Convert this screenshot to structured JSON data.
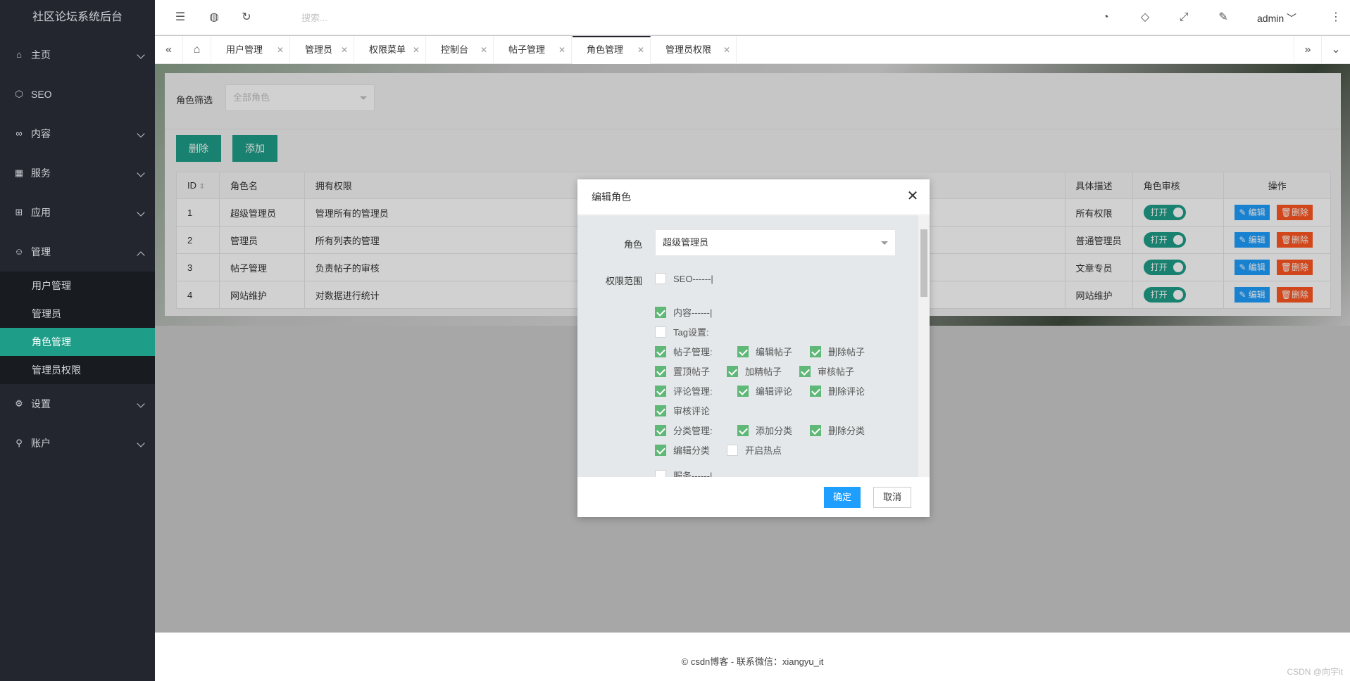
{
  "sidebar": {
    "title": "社区论坛系统后台",
    "groups": [
      {
        "label": "主页",
        "icon": "home-icon"
      },
      {
        "label": "SEO",
        "icon": "cube-icon"
      },
      {
        "label": "内容",
        "icon": "binoculars-icon"
      },
      {
        "label": "服务",
        "icon": "grid-icon"
      },
      {
        "label": "应用",
        "icon": "apps-icon"
      },
      {
        "label": "管理",
        "icon": "users-icon"
      },
      {
        "label": "设置",
        "icon": "gear-icon"
      },
      {
        "label": "账户",
        "icon": "user-icon"
      }
    ],
    "sub_items": [
      "用户管理",
      "管理员",
      "角色管理",
      "管理员权限"
    ],
    "active_sub": "角色管理"
  },
  "topbar": {
    "search_placeholder": "搜索...",
    "user": "admin"
  },
  "tabs": [
    {
      "label": "用户管理"
    },
    {
      "label": "管理员"
    },
    {
      "label": "权限菜单"
    },
    {
      "label": "控制台"
    },
    {
      "label": "帖子管理"
    },
    {
      "label": "角色管理",
      "active": true
    },
    {
      "label": "管理员权限"
    }
  ],
  "filter": {
    "label": "角色筛选",
    "placeholder": "全部角色"
  },
  "buttons": {
    "delete": "删除",
    "add": "添加"
  },
  "table": {
    "headers": [
      "ID",
      "角色名",
      "拥有权限",
      "具体描述",
      "角色审核",
      "操作"
    ],
    "rows": [
      {
        "id": "1",
        "name": "超级管理员",
        "perm": "管理所有的管理员",
        "desc": "所有权限"
      },
      {
        "id": "2",
        "name": "管理员",
        "perm": "所有列表的管理",
        "desc": "普通管理员"
      },
      {
        "id": "3",
        "name": "帖子管理",
        "perm": "负责帖子的审核",
        "desc": "文章专员"
      },
      {
        "id": "4",
        "name": "网站维护",
        "perm": "对数据进行统计",
        "desc": "网站维护"
      }
    ],
    "toggle_label": "打开",
    "edit_label": "编辑",
    "delete_label": "删除"
  },
  "modal": {
    "title": "编辑角色",
    "role_label": "角色",
    "role_value": "超级管理员",
    "scope_label": "权限范围",
    "checks": {
      "seo": "SEO------|",
      "content": "内容------|",
      "tag": "Tag设置:",
      "post_mgmt": "帖子管理:",
      "post_edit": "编辑帖子",
      "post_delete": "删除帖子",
      "post_top": "置顶帖子",
      "post_feature": "加精帖子",
      "post_review": "审核帖子",
      "comment_mgmt": "评论管理:",
      "comment_edit": "编辑评论",
      "comment_delete": "删除评论",
      "comment_review": "审核评论",
      "cat_mgmt": "分类管理:",
      "cat_add": "添加分类",
      "cat_delete": "删除分类",
      "cat_edit": "编辑分类",
      "hot": "开启热点",
      "service": "服务------|"
    },
    "confirm": "确定",
    "cancel": "取消"
  },
  "footer": {
    "text": "© csdn博客 - 联系微信：xiangyu_it",
    "watermark": "CSDN @向宇it"
  },
  "colors": {
    "accent": "#1e9e88",
    "blue": "#1e9fff",
    "red": "#ff5722",
    "check": "#5fb878",
    "sidebar": "#23262e"
  }
}
